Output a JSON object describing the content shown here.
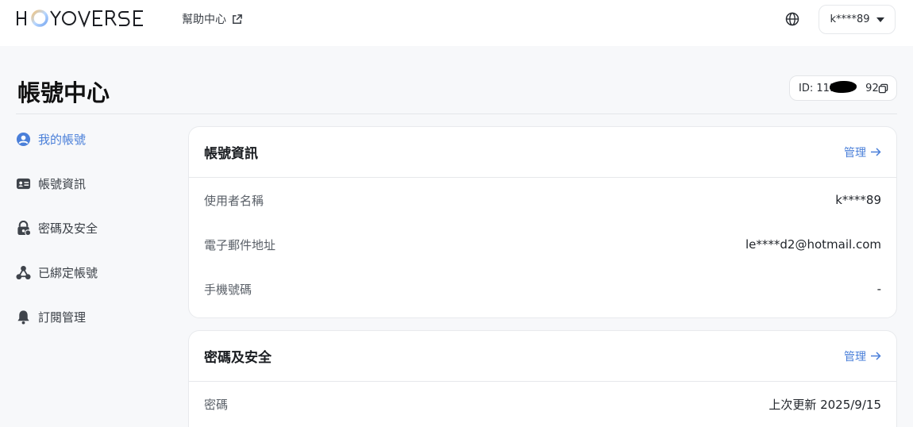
{
  "header": {
    "logo_text": "HOYOVERSE",
    "help_label": "幫助中心",
    "user_label": "k****89"
  },
  "page": {
    "title": "帳號中心",
    "id_label": "ID: 111",
    "id_suffix": "92"
  },
  "sidebar": {
    "items": [
      {
        "label": "我的帳號",
        "icon": "user-circle-icon",
        "active": true
      },
      {
        "label": "帳號資訊",
        "icon": "id-card-icon",
        "active": false
      },
      {
        "label": "密碼及安全",
        "icon": "lock-icon",
        "active": false
      },
      {
        "label": "已綁定帳號",
        "icon": "link-nodes-icon",
        "active": false
      },
      {
        "label": "訂閱管理",
        "icon": "bell-icon",
        "active": false
      }
    ]
  },
  "account_card": {
    "title": "帳號資訊",
    "manage_label": "管理",
    "rows": [
      {
        "label": "使用者名稱",
        "value": "k****89"
      },
      {
        "label": "電子郵件地址",
        "value": "le****d2@hotmail.com"
      },
      {
        "label": "手機號碼",
        "value": "-"
      }
    ]
  },
  "security_card": {
    "title": "密碼及安全",
    "manage_label": "管理",
    "rows": [
      {
        "label": "密碼",
        "value": "上次更新 2025/9/15"
      }
    ]
  },
  "colors": {
    "accent": "#4a7fd9",
    "background": "#f7f8fa"
  }
}
